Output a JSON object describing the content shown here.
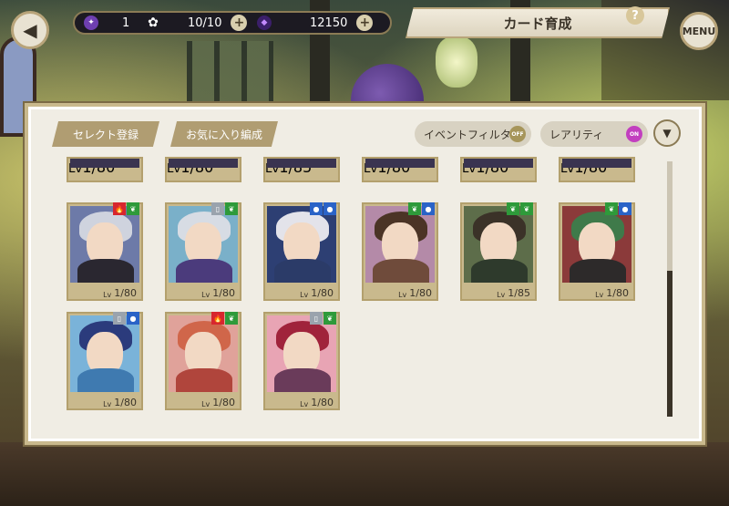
{
  "header": {
    "title": "カード育成",
    "menu_label": "MENU",
    "help_label": "?",
    "back_label": "◀",
    "resources": [
      {
        "icon": "purple-star-icon",
        "value": "1"
      },
      {
        "icon": "flower-icon",
        "value": "10/10"
      },
      {
        "icon": "magic-gem-icon",
        "value": "12150"
      }
    ]
  },
  "toolbar": {
    "select_register": "セレクト登録",
    "favorites_edit": "お気に入り編成",
    "event_filter": "イベントフィルタ",
    "event_filter_state": "OFF",
    "rarity": "レアリティ",
    "rarity_state": "ON"
  },
  "top_row": [
    {
      "level": "1/80"
    },
    {
      "level": "1/80"
    },
    {
      "level": "1/85"
    },
    {
      "level": "1/80"
    },
    {
      "level": "1/80"
    },
    {
      "level": "1/80"
    }
  ],
  "cards": [
    {
      "level": "1/80",
      "badges": [
        "fire",
        "wind"
      ],
      "hair": "#cfd3de",
      "body": "#2a2730",
      "bg": "#6d7aa8"
    },
    {
      "level": "1/80",
      "badges": [
        "blank",
        "wind"
      ],
      "hair": "#d7dce4",
      "body": "#4b3b7c",
      "bg": "#7ab0c9"
    },
    {
      "level": "1/80",
      "badges": [
        "water",
        "water"
      ],
      "hair": "#e3e3ea",
      "body": "#2b3b68",
      "bg": "#2d3f73"
    },
    {
      "level": "1/80",
      "badges": [
        "wind",
        "water"
      ],
      "hair": "#4b3426",
      "body": "#6f4b3b",
      "bg": "#b48aa8"
    },
    {
      "level": "1/85",
      "badges": [
        "wind",
        "wind"
      ],
      "hair": "#3b3228",
      "body": "#2e3a2c",
      "bg": "#5d6d4a"
    },
    {
      "level": "1/80",
      "badges": [
        "wind",
        "water"
      ],
      "hair": "#3f7a4a",
      "body": "#2d2a2a",
      "bg": "#8b3a3a"
    },
    {
      "level": "1/80",
      "badges": [
        "blank",
        "water"
      ],
      "hair": "#2b3b7c",
      "body": "#3f7ab0",
      "bg": "#7ab3d9"
    },
    {
      "level": "1/80",
      "badges": [
        "fire",
        "wind"
      ],
      "hair": "#d0664a",
      "body": "#b0453c",
      "bg": "#e0a29a"
    },
    {
      "level": "1/80",
      "badges": [
        "blank",
        "wind"
      ],
      "hair": "#a0233b",
      "body": "#6a3b5a",
      "bg": "#e8a4b4"
    }
  ],
  "badge_colors": {
    "fire": "#d7262e",
    "wind": "#2e9a3a",
    "water": "#2a63c7",
    "blank": "#9aa3ad"
  },
  "badge_icons": {
    "fire": "🔥",
    "wind": "❦",
    "water": "●",
    "blank": "▯"
  },
  "level_prefix": "Lv"
}
